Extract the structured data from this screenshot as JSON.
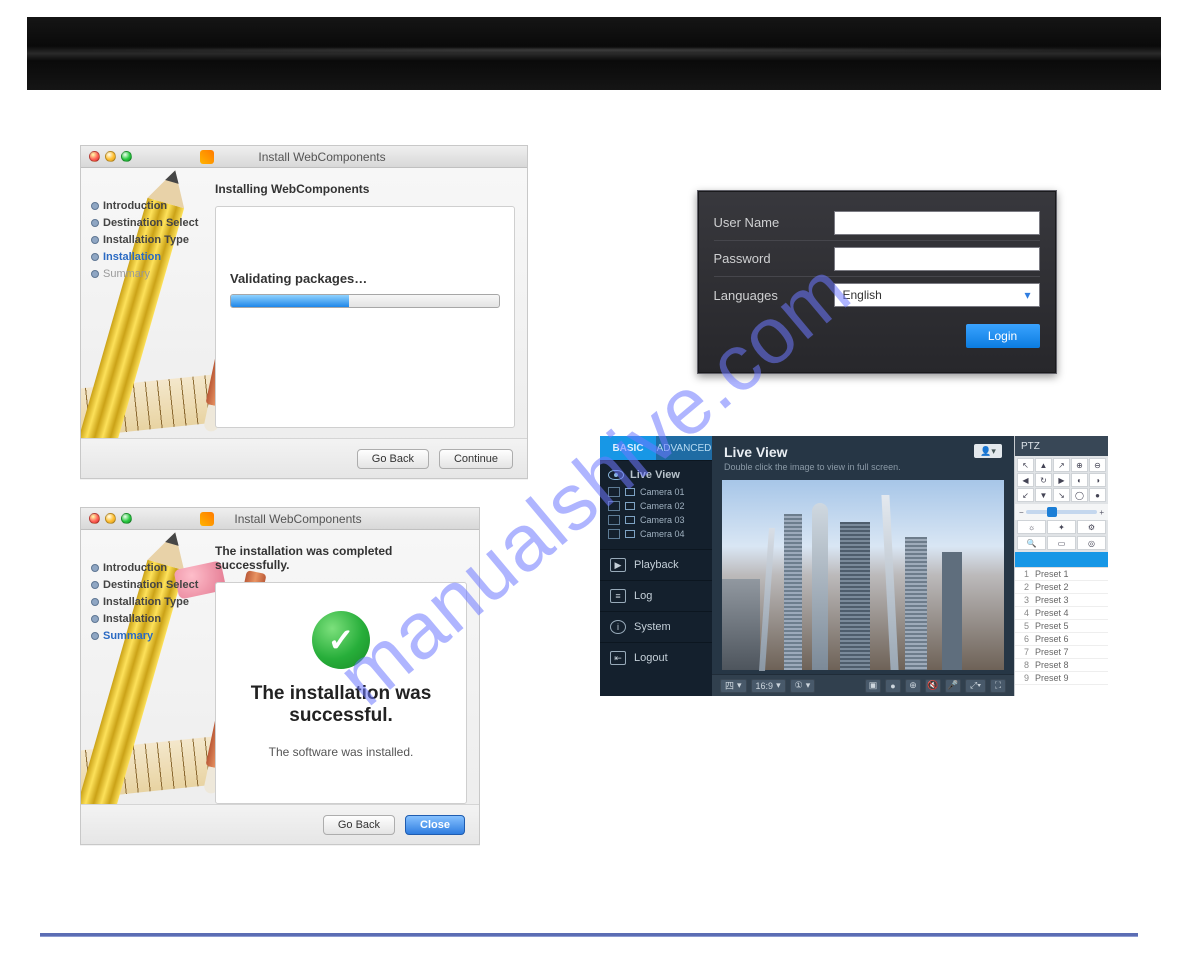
{
  "installer1": {
    "window_title": "Install WebComponents",
    "heading": "Installing WebComponents",
    "steps": [
      "Introduction",
      "Destination Select",
      "Installation Type",
      "Installation",
      "Summary"
    ],
    "active_step_index": 3,
    "status_text": "Validating packages…",
    "btn_back": "Go Back",
    "btn_continue": "Continue"
  },
  "installer2": {
    "window_title": "Install WebComponents",
    "heading": "The installation was completed successfully.",
    "steps": [
      "Introduction",
      "Destination Select",
      "Installation Type",
      "Installation",
      "Summary"
    ],
    "active_step_index": 4,
    "success_title": "The installation was successful.",
    "success_sub": "The software was installed.",
    "btn_back": "Go Back",
    "btn_close": "Close"
  },
  "login": {
    "label_user": "User Name",
    "label_pass": "Password",
    "label_lang": "Languages",
    "lang_value": "English",
    "btn_login": "Login"
  },
  "liveview": {
    "tabs": {
      "basic": "BASIC",
      "advanced": "ADVANCED"
    },
    "title": "Live View",
    "subtitle": "Double click the image to view in full screen.",
    "nav": {
      "liveview": "Live View",
      "playback": "Playback",
      "log": "Log",
      "system": "System",
      "logout": "Logout"
    },
    "cameras": [
      "Camera 01",
      "Camera 02",
      "Camera 03",
      "Camera 04"
    ],
    "toolbar": {
      "layout": "四",
      "aspect": "16:9",
      "stream": "①"
    },
    "ptz_title": "PTZ",
    "presets": [
      "Preset 1",
      "Preset 2",
      "Preset 3",
      "Preset 4",
      "Preset 5",
      "Preset 6",
      "Preset 7",
      "Preset 8",
      "Preset 9"
    ]
  },
  "watermark": "manualshive.com"
}
